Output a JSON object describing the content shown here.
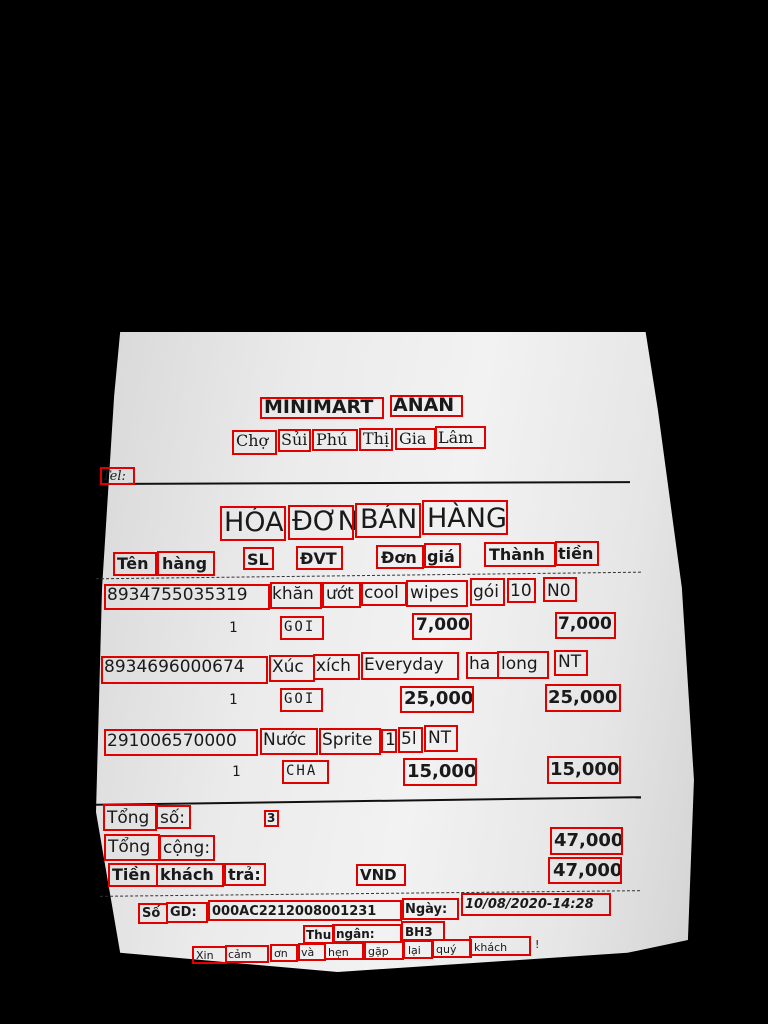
{
  "store": {
    "name_words": [
      "MINIMART",
      "ANAN"
    ],
    "address_words": [
      "Chợ",
      "Sủi",
      "Phú",
      "Thị",
      "Gia",
      "Lâm"
    ],
    "tel_label": "Tel:"
  },
  "title_words": [
    "HÓA",
    "ĐƠN",
    "BÁN",
    "HÀNG"
  ],
  "columns": {
    "name": [
      "Tên",
      "hàng"
    ],
    "qty": "SL",
    "unit": "ĐVT",
    "price": [
      "Đơn",
      "giá"
    ],
    "amount": [
      "Thành",
      "tiền"
    ]
  },
  "items": [
    {
      "barcode": "8934755035319",
      "desc_words": [
        "khăn",
        "ướt",
        "cool",
        "wipes",
        "gói",
        "10",
        "N0"
      ],
      "qty": "1",
      "unit": "GOI",
      "price": "7,000",
      "amount": "7,000"
    },
    {
      "barcode": "8934696000674",
      "desc_words": [
        "Xúc",
        "xích",
        "Everyday",
        "ha",
        "long",
        "NT"
      ],
      "qty": "1",
      "unit": "GOI",
      "price": "25,000",
      "amount": "25,000"
    },
    {
      "barcode": "291006570000",
      "desc_words": [
        "Nước",
        "Sprite",
        "1",
        "5l",
        "NT"
      ],
      "qty": "1",
      "unit": "CHA",
      "price": "15,000",
      "amount": "15,000"
    }
  ],
  "totals": {
    "count_label": [
      "Tổng",
      "số:"
    ],
    "count_value": "3",
    "total_label": [
      "Tổng",
      "cộng:"
    ],
    "total_value": "47,000",
    "paid_label": [
      "Tiền",
      "khách",
      "trả:"
    ],
    "paid_currency": "VND",
    "paid_value": "47,000"
  },
  "footer": {
    "txn_label": [
      "Số",
      "GD:"
    ],
    "txn_id": "000AC2212008001231",
    "date_label": "Ngày:",
    "date_value": "10/08/2020-14:28",
    "cashier_label": [
      "Thu",
      "ngân:"
    ],
    "cashier_value": "BH3",
    "thanks_words": [
      "Xin",
      "cảm",
      "ơn",
      "và",
      "hẹn",
      "gặp",
      "lại",
      "quý",
      "khách"
    ],
    "thanks_tail": "!"
  },
  "colors": {
    "page_background": "#000000",
    "annotation_box": "#e00000",
    "paper": "#ececec",
    "ink": "#1a1a1a"
  }
}
